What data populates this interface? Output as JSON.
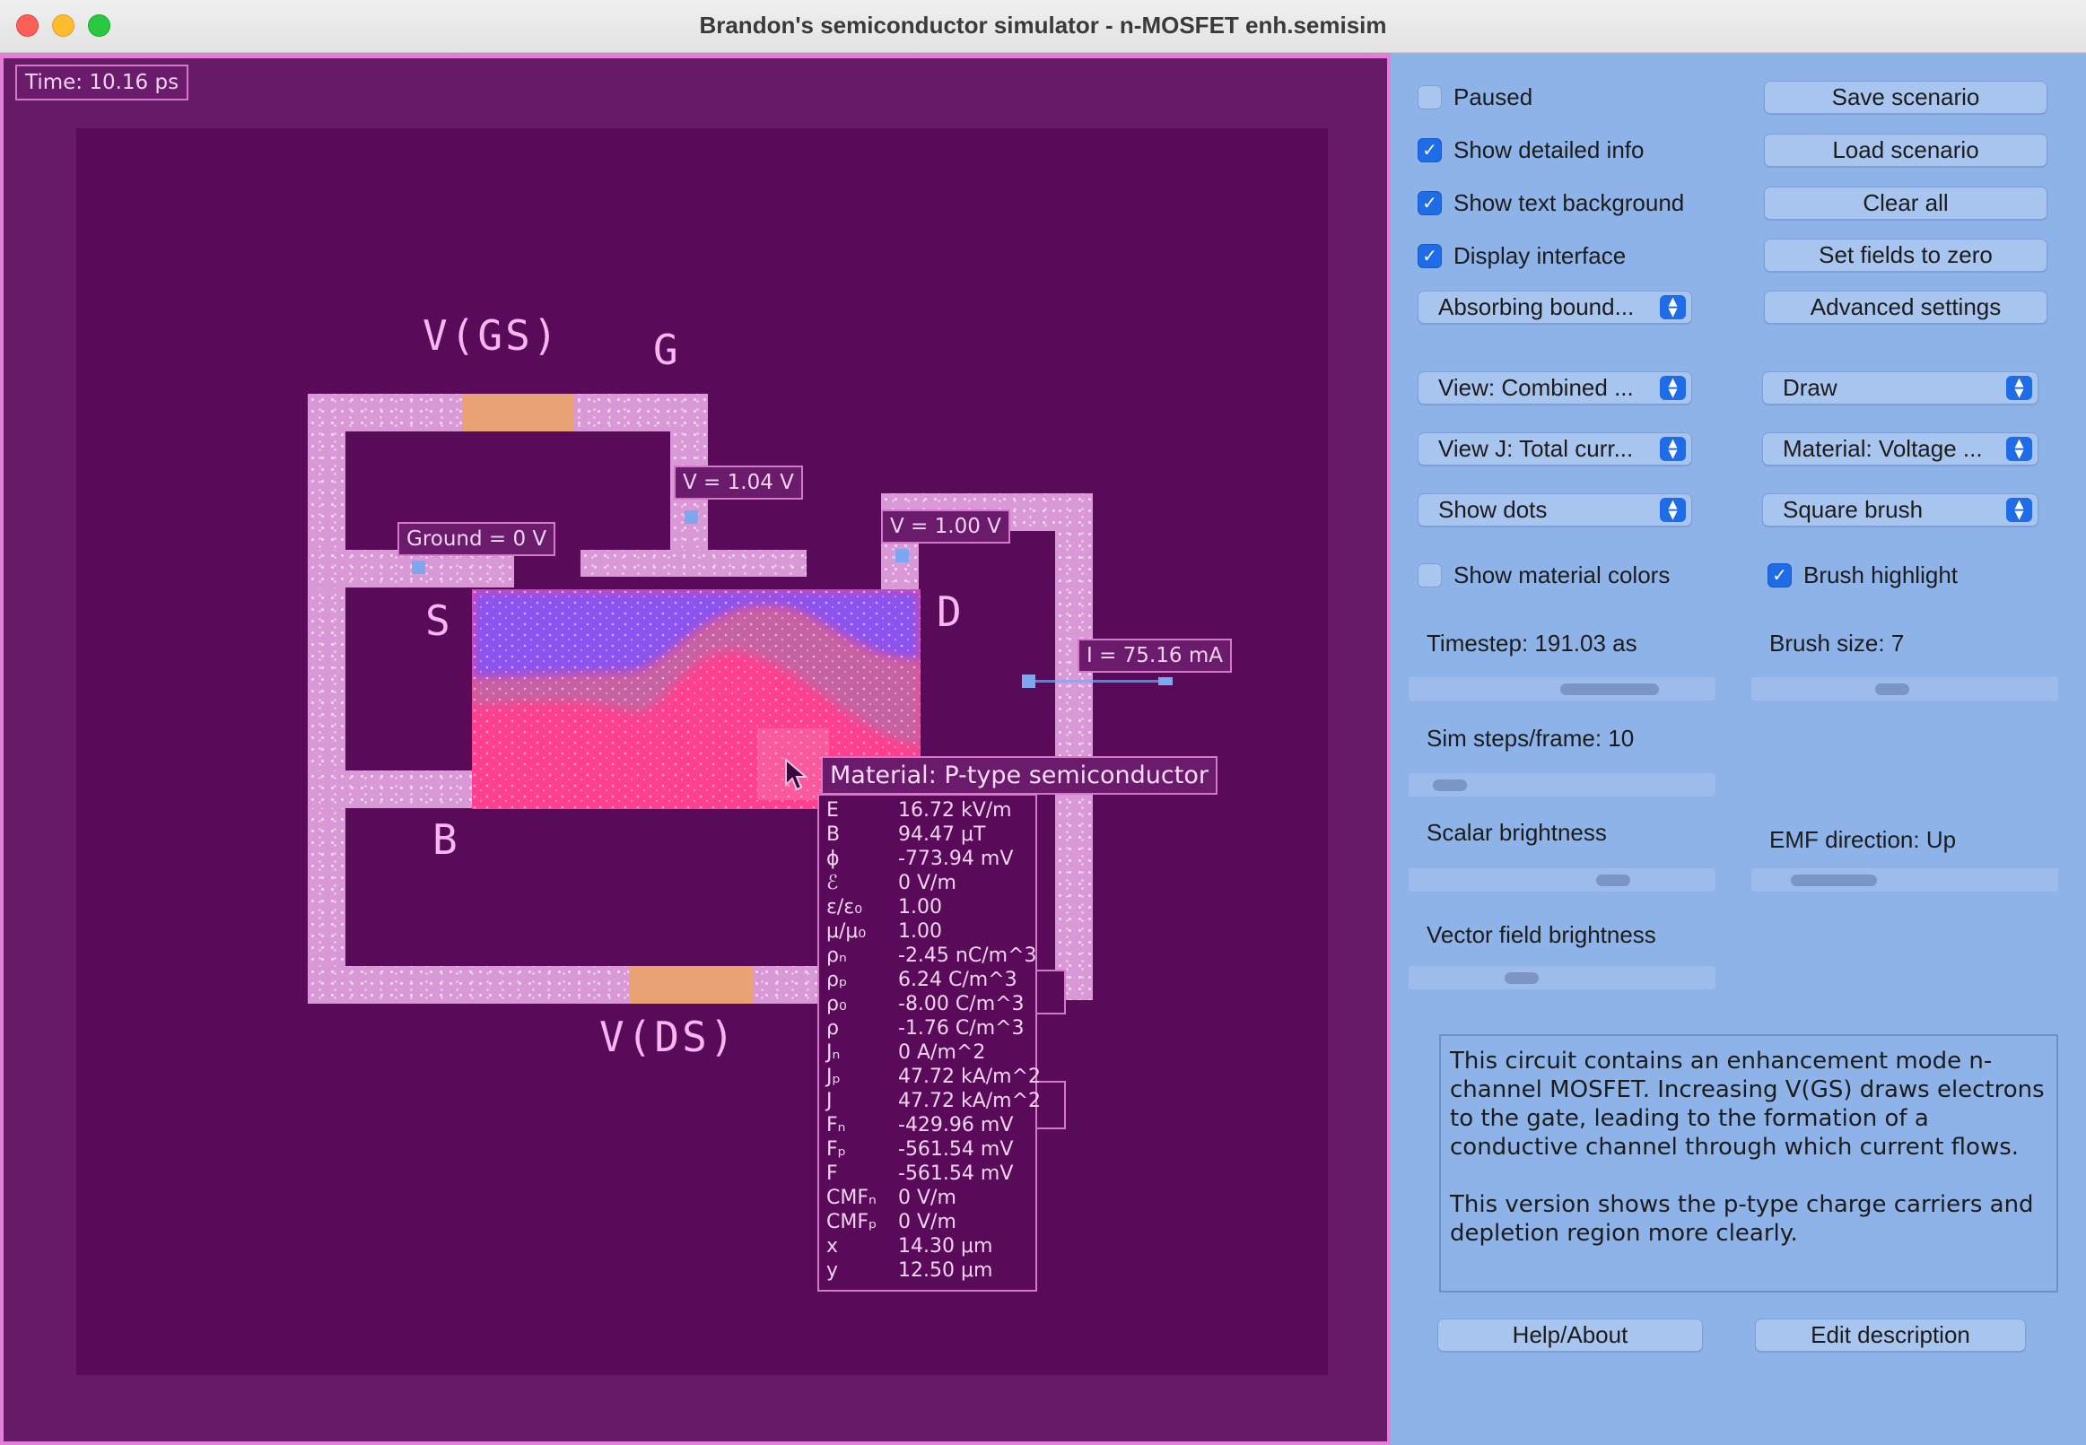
{
  "window": {
    "title": "Brandon's semiconductor simulator - n-MOSFET enh.semisim"
  },
  "sim": {
    "time_label": "Time: 10.16 ps",
    "labels": {
      "vgs": "V(GS)",
      "g": "G",
      "s": "S",
      "d": "D",
      "b": "B",
      "vds": "V(DS)"
    },
    "tags": {
      "gate_voltage": "V = 1.04 V",
      "ground": "Ground = 0 V",
      "drain_voltage": "V = 1.00 V",
      "current": "I = 75.16 mA"
    },
    "info": {
      "title": "Material: P-type semiconductor",
      "rows": [
        {
          "k": "E",
          "v": "16.72 kV/m"
        },
        {
          "k": "B",
          "v": "94.47 μT"
        },
        {
          "k": "ϕ",
          "v": "-773.94 mV"
        },
        {
          "k": "ℰ",
          "v": "0 V/m"
        },
        {
          "k": "ε/ε₀",
          "v": "1.00"
        },
        {
          "k": "μ/μ₀",
          "v": "1.00"
        },
        {
          "k": "ρₙ",
          "v": "-2.45 nC/m^3"
        },
        {
          "k": "ρₚ",
          "v": "6.24 C/m^3"
        },
        {
          "k": "ρ₀",
          "v": "-8.00 C/m^3"
        },
        {
          "k": "ρ",
          "v": "-1.76 C/m^3"
        },
        {
          "k": "Jₙ",
          "v": "0 A/m^2"
        },
        {
          "k": "Jₚ",
          "v": "47.72 kA/m^2"
        },
        {
          "k": "J",
          "v": "47.72 kA/m^2"
        },
        {
          "k": "Fₙ",
          "v": "-429.96 mV"
        },
        {
          "k": "Fₚ",
          "v": "-561.54 mV"
        },
        {
          "k": "F",
          "v": "-561.54 mV"
        },
        {
          "k": "CMFₙ",
          "v": "0 V/m"
        },
        {
          "k": "CMFₚ",
          "v": "0 V/m"
        },
        {
          "k": "x",
          "v": "14.30 μm"
        },
        {
          "k": "y",
          "v": "12.50 μm"
        }
      ]
    },
    "colors": {
      "background": "#671a68",
      "canvas": "#590b5a",
      "wire": "#d998d6",
      "battery": "#e9a273",
      "electrons": "#8b52f0",
      "holes": "#ff3f8f"
    }
  },
  "panel": {
    "checkboxes": {
      "paused": {
        "label": "Paused",
        "checked": false
      },
      "detailed_info": {
        "label": "Show detailed info",
        "checked": true
      },
      "text_background": {
        "label": "Show text background",
        "checked": true
      },
      "display_interface": {
        "label": "Display interface",
        "checked": true
      },
      "material_colors": {
        "label": "Show material colors",
        "checked": false
      },
      "brush_highlight": {
        "label": "Brush highlight",
        "checked": true
      }
    },
    "buttons": {
      "save": "Save scenario",
      "load": "Load scenario",
      "clear": "Clear all",
      "zero": "Set fields to zero",
      "advanced": "Advanced settings",
      "help": "Help/About",
      "edit_desc": "Edit description"
    },
    "selects": {
      "boundary": "Absorbing bound...",
      "view": "View: Combined ...",
      "draw": "Draw",
      "view_j": "View J: Total curr...",
      "material": "Material: Voltage ...",
      "dots": "Show dots",
      "brush": "Square brush"
    },
    "sliders": {
      "timestep": {
        "label": "Timestep: 191.03 as",
        "value": 0.75
      },
      "brush_size": {
        "label": "Brush size: 7",
        "value": 0.45
      },
      "steps": {
        "label": "Sim steps/frame: 10",
        "value": 0.06
      },
      "scalar": {
        "label": "Scalar brightness",
        "value": 0.7
      },
      "emf": {
        "label": "EMF direction: Up",
        "value": 0.15
      },
      "vector": {
        "label": "Vector field brightness",
        "value": 0.34
      }
    },
    "description": {
      "p1": "This circuit contains an enhancement mode n-channel MOSFET. Increasing V(GS) draws electrons to the gate, leading to the formation of a conductive channel through which current flows.",
      "p2": "This version shows the p-type charge carriers and depletion region more clearly."
    },
    "colors": {
      "panel": "#8eb3e8",
      "button": "#a8c5f0",
      "accent": "#1f6ce8"
    }
  }
}
